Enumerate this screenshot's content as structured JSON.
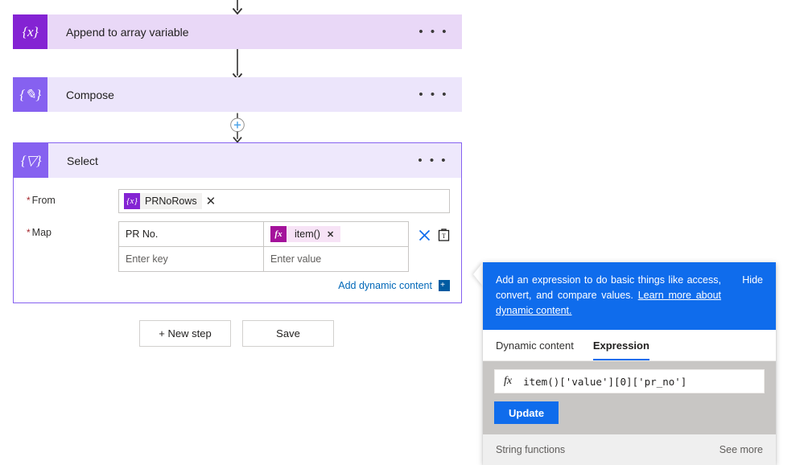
{
  "flow": {
    "steps": [
      {
        "id": "append-to-array-variable",
        "title": "Append to array variable",
        "icon": "variable-braces-x-icon",
        "icon_glyph": "{x}",
        "ellipsis": "• • •",
        "header_bg": "#e9d8f7",
        "icon_bg": "#8423d3"
      },
      {
        "id": "compose",
        "title": "Compose",
        "icon": "compose-pencil-braces-icon",
        "icon_glyph": "{✎}",
        "ellipsis": "• • •",
        "header_bg": "#ece5fb",
        "icon_bg": "#8661f0"
      },
      {
        "id": "select",
        "title": "Select",
        "icon": "select-filter-braces-icon",
        "icon_glyph": "{▽}",
        "ellipsis": "• • •",
        "header_bg": "#eee8fc",
        "icon_bg": "#8661f0"
      }
    ],
    "add_step_node": "insert-step-plus-icon"
  },
  "select_card": {
    "from": {
      "label": "From",
      "required_marker": "*",
      "token": {
        "icon": "variable-braces-x-icon",
        "icon_glyph": "{x}",
        "text": "PRNoRows",
        "remove": "✕"
      }
    },
    "map": {
      "label": "Map",
      "required_marker": "*",
      "columns": [
        "key",
        "value"
      ],
      "rows": [
        {
          "key": "PR No.",
          "key_is_placeholder": false,
          "value_token": {
            "icon": "expression-fx-icon",
            "icon_glyph": "fx",
            "text": "item()",
            "remove": "✕"
          }
        },
        {
          "key": "Enter key",
          "key_is_placeholder": true,
          "value": "Enter value",
          "value_is_placeholder": true
        }
      ],
      "row_actions": {
        "delete": "delete-row-icon",
        "clipboard": "clipboard-text-icon"
      }
    },
    "add_dynamic_content": {
      "label": "Add dynamic content",
      "badge": "+"
    }
  },
  "bottom_actions": {
    "new_step": "+ New step",
    "save": "Save"
  },
  "expression_panel": {
    "banner": {
      "text": "Add an expression to do basic things like access, convert, and compare values. ",
      "link_text": "Learn more about dynamic content.",
      "hide_label": "Hide"
    },
    "tabs": [
      {
        "label": "Dynamic content",
        "active": false
      },
      {
        "label": "Expression",
        "active": true
      }
    ],
    "editor": {
      "fx_glyph": "fx",
      "value": "item()['value'][0]['pr_no']",
      "update_label": "Update"
    },
    "functions": {
      "category": "String functions",
      "see_more": "See more"
    }
  },
  "colors": {
    "accent_blue": "#0f6cec",
    "link_blue": "#0067b8",
    "variable_purple": "#8423d3",
    "step_purple": "#8661f0",
    "expression_magenta": "#a4129b",
    "required_red": "#a4262c"
  }
}
